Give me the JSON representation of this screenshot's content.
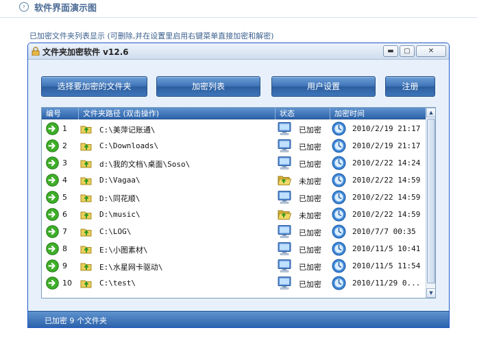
{
  "section": {
    "title": "软件界面演示图"
  },
  "caption": "已加密文件夹列表显示 (可删除,并在设置里启用右键菜单直接加密和解密)",
  "window": {
    "title": "文件夹加密软件 v12.6",
    "controls": {
      "minimize": "▬",
      "maximize": "▢",
      "close": "✕"
    }
  },
  "toolbar": {
    "select_folder": "选择要加密的文件夹",
    "encrypt_list": "加密列表",
    "user_settings": "用户设置",
    "register": "注册"
  },
  "table": {
    "headers": {
      "num": "编号",
      "path": "文件夹路径 (双击操作)",
      "status": "状态",
      "time": "加密时间"
    },
    "rows": [
      {
        "num": "1",
        "path": "C:\\美萍记账通\\",
        "status": "已加密",
        "time": "2010/2/19 21:17",
        "encrypted": true
      },
      {
        "num": "2",
        "path": "C:\\Downloads\\",
        "status": "已加密",
        "time": "2010/2/19 21:17",
        "encrypted": true
      },
      {
        "num": "3",
        "path": "d:\\我的文档\\桌面\\Soso\\",
        "status": "已加密",
        "time": "2010/2/22 14:24",
        "encrypted": true
      },
      {
        "num": "4",
        "path": "D:\\Vagaa\\",
        "status": "未加密",
        "time": "2010/2/22 14:59",
        "encrypted": false
      },
      {
        "num": "5",
        "path": "D:\\同花顺\\",
        "status": "已加密",
        "time": "2010/2/22 14:59",
        "encrypted": true
      },
      {
        "num": "6",
        "path": "D:\\music\\",
        "status": "未加密",
        "time": "2010/2/22 14:59",
        "encrypted": false
      },
      {
        "num": "7",
        "path": "C:\\LOG\\",
        "status": "已加密",
        "time": "2010/7/7 00:35",
        "encrypted": true
      },
      {
        "num": "8",
        "path": "E:\\小图素材\\",
        "status": "已加密",
        "time": "2010/11/5 10:41",
        "encrypted": true
      },
      {
        "num": "9",
        "path": "E:\\水星网卡驱动\\",
        "status": "已加密",
        "time": "2010/11/5 11:54",
        "encrypted": true
      },
      {
        "num": "10",
        "path": "C:\\test\\",
        "status": "已加密",
        "time": "2010/11/29 0...",
        "encrypted": true
      }
    ]
  },
  "scrollbar": {
    "up": "▲",
    "down": "▼"
  },
  "statusbar": {
    "text": "已加密 9 个文件夹"
  },
  "icons": {
    "row_arrow": "green-arrow-icon",
    "row_folder": "folder-up-icon",
    "encrypted": "monitor-icon",
    "unencrypted": "open-folder-icon",
    "time": "globe-icon"
  },
  "colors": {
    "accent": "#2c62aa",
    "button": "#3e72b6",
    "title_text": "#4a6a94"
  }
}
